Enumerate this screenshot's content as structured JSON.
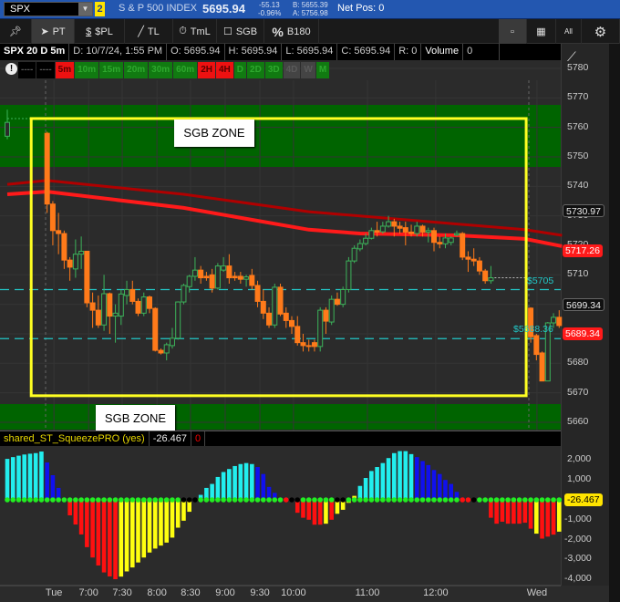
{
  "header": {
    "symbol": "SPX",
    "badge": "2",
    "description": "S & P 500 INDEX",
    "last": "5695.94",
    "change": "-55.13",
    "change_pct": "-0.96%",
    "bid": "B: 5655.39",
    "ask": "A: 5756.98",
    "net_pos": "Net Pos: 0"
  },
  "toolbar": {
    "pt": "PT",
    "spl": "$PL",
    "tl": "TL",
    "tml": "TmL",
    "sgb": "SGB",
    "b180": "B180",
    "all": "All"
  },
  "info": {
    "title": "SPX 20 D 5m",
    "date": "D: 10/7/24, 1:55 PM",
    "open": "O: 5695.94",
    "high": "H: 5695.94",
    "low": "L: 5695.94",
    "close": "C: 5695.94",
    "range": "R: 0",
    "volume_label": "Volume",
    "volume": "0"
  },
  "timeframes": [
    {
      "l": "----",
      "c": "k"
    },
    {
      "l": "----",
      "c": "k"
    },
    {
      "l": "5m",
      "c": "r"
    },
    {
      "l": "10m",
      "c": "g"
    },
    {
      "l": "15m",
      "c": "g"
    },
    {
      "l": "20m",
      "c": "g"
    },
    {
      "l": "30m",
      "c": "g"
    },
    {
      "l": "60m",
      "c": "g"
    },
    {
      "l": "2H",
      "c": "r"
    },
    {
      "l": "4H",
      "c": "r"
    },
    {
      "l": "D",
      "c": "g"
    },
    {
      "l": "2D",
      "c": "g"
    },
    {
      "l": "3D",
      "c": "g"
    },
    {
      "l": "4D",
      "c": "x"
    },
    {
      "l": "W",
      "c": "x"
    },
    {
      "l": "M",
      "c": "g"
    }
  ],
  "annotations": {
    "zone_top": "SGB ZONE",
    "zone_bottom": "SGB ZONE",
    "level1": "$5705",
    "level2": "$5688.36"
  },
  "price_tags": {
    "t1": "5730.97",
    "t2": "5717.26",
    "t3": "5699.34",
    "t4": "5689.34"
  },
  "lower": {
    "study": "shared_ST_SqueezePRO (yes)",
    "value": "-26.467",
    "zero": "0",
    "tag": "-26.467"
  },
  "colors": {
    "up": "#3cb35a",
    "down": "#ff7a1a",
    "zone": "#006400",
    "box": "#ffff22",
    "ma_dark": "#b00000",
    "ma_bright": "#ff1a1a",
    "level": "#22c8c8"
  },
  "chart_data": [
    {
      "type": "candlestick",
      "title": "SPX 20 D 5m",
      "ylim": [
        5655,
        5785
      ],
      "yticks": [
        "5780",
        "5770",
        "5760",
        "5750",
        "5740",
        "5730",
        "5720",
        "5710",
        "5700",
        "5690",
        "5680",
        "5670",
        "5660"
      ],
      "xticks": [
        {
          "l": "Tue",
          "slot": 8.2
        },
        {
          "l": "7:00",
          "slot": 14.3
        },
        {
          "l": "7:30",
          "slot": 20.2
        },
        {
          "l": "8:00",
          "slot": 26.3
        },
        {
          "l": "8:30",
          "slot": 32.2
        },
        {
          "l": "9:00",
          "slot": 38.3
        },
        {
          "l": "9:30",
          "slot": 44.4
        },
        {
          "l": "10:00",
          "slot": 50.3
        },
        {
          "l": "11:00",
          "slot": 63.3
        },
        {
          "l": "12:00",
          "slot": 75.3
        },
        {
          "l": "Wed",
          "slot": 93.1
        }
      ],
      "candles": [
        [
          0,
          5757,
          5766,
          5756,
          5761.7
        ],
        [
          7,
          5758,
          5758.5,
          5731,
          5734
        ],
        [
          8,
          5734,
          5735,
          5720,
          5725
        ],
        [
          9,
          5725,
          5731,
          5717,
          5724
        ],
        [
          10,
          5724,
          5725,
          5712,
          5715
        ],
        [
          11,
          5715,
          5716,
          5708,
          5712.6
        ],
        [
          12,
          5712,
          5722,
          5709,
          5717
        ],
        [
          13,
          5717,
          5723,
          5712,
          5718
        ],
        [
          14,
          5718,
          5718,
          5699,
          5700.5
        ],
        [
          15,
          5700.5,
          5704,
          5692,
          5698
        ],
        [
          16,
          5698,
          5703,
          5692,
          5693
        ],
        [
          17,
          5693,
          5710,
          5691,
          5703.6
        ],
        [
          18,
          5703.6,
          5704,
          5690,
          5696
        ],
        [
          19,
          5696,
          5700,
          5687,
          5697
        ],
        [
          20,
          5696,
          5705,
          5693,
          5703.5
        ],
        [
          21,
          5703,
          5708,
          5700,
          5705
        ],
        [
          22,
          5705,
          5708,
          5700,
          5701
        ],
        [
          23,
          5701,
          5702,
          5696,
          5697
        ],
        [
          24,
          5697,
          5704,
          5696,
          5702.5
        ],
        [
          25,
          5702.5,
          5703,
          5697,
          5698.6
        ],
        [
          26,
          5698.6,
          5699,
          5684,
          5684.4
        ],
        [
          27,
          5684.4,
          5685,
          5683,
          5683.5
        ],
        [
          28,
          5683.5,
          5687,
          5681,
          5686.3
        ],
        [
          29,
          5686,
          5692,
          5685,
          5688.5
        ],
        [
          30,
          5688.5,
          5701,
          5688,
          5700.8
        ],
        [
          31,
          5700.8,
          5707,
          5700,
          5706.4
        ],
        [
          32,
          5706,
          5710,
          5704,
          5709.5
        ],
        [
          33,
          5709.5,
          5716,
          5708,
          5711.6
        ],
        [
          34,
          5711.6,
          5713,
          5707,
          5709
        ],
        [
          35,
          5709.5,
          5711,
          5708,
          5709
        ],
        [
          36,
          5710,
          5712,
          5704,
          5705.5
        ],
        [
          37,
          5705.5,
          5714,
          5705,
          5713
        ],
        [
          38,
          5711.6,
          5716,
          5711,
          5713
        ],
        [
          39,
          5713,
          5717,
          5707,
          5709
        ],
        [
          40,
          5709.5,
          5711,
          5708,
          5709
        ],
        [
          41,
          5709.5,
          5711,
          5707,
          5708.5
        ],
        [
          42,
          5708.5,
          5710,
          5706,
          5709.3
        ],
        [
          43,
          5709.8,
          5712,
          5705,
          5706.4
        ],
        [
          44,
          5706.4,
          5708,
          5699,
          5701
        ],
        [
          45,
          5701,
          5705,
          5695,
          5697
        ],
        [
          46,
          5697,
          5699,
          5692,
          5693
        ],
        [
          47,
          5693,
          5707,
          5692,
          5705.8
        ],
        [
          48,
          5705.8,
          5707,
          5696,
          5696.7
        ],
        [
          49,
          5697,
          5699,
          5692,
          5694.5
        ],
        [
          50,
          5694.5,
          5696,
          5690,
          5692.5
        ],
        [
          51,
          5692.5,
          5696,
          5686,
          5687
        ],
        [
          52,
          5687,
          5690,
          5684,
          5686
        ],
        [
          53,
          5686,
          5688,
          5684,
          5685.7
        ],
        [
          54,
          5687,
          5688,
          5684,
          5685.7
        ],
        [
          55,
          5685.7,
          5699,
          5684,
          5698
        ],
        [
          56,
          5698,
          5699,
          5690,
          5694.3
        ],
        [
          57,
          5694,
          5703,
          5693,
          5701.7
        ],
        [
          58,
          5701.7,
          5704,
          5699.5,
          5700
        ],
        [
          59,
          5700,
          5706,
          5699,
          5705
        ],
        [
          60,
          5705,
          5716,
          5704,
          5714.7
        ],
        [
          61,
          5714.7,
          5720,
          5714,
          5719
        ],
        [
          62,
          5718.8,
          5722,
          5718,
          5720.6
        ],
        [
          63,
          5720.6,
          5724,
          5720,
          5722.4
        ],
        [
          64,
          5722.4,
          5726,
          5722,
          5725
        ],
        [
          65,
          5725,
          5728,
          5723,
          5724.5
        ],
        [
          66,
          5724.6,
          5728,
          5724,
          5726.5
        ],
        [
          67,
          5726.5,
          5730,
          5726,
          5728
        ],
        [
          68,
          5728,
          5729,
          5723,
          5726.5
        ],
        [
          69,
          5726.5,
          5728,
          5724,
          5725.8
        ],
        [
          70,
          5726,
          5728,
          5720,
          5724.5
        ],
        [
          71,
          5724.5,
          5727,
          5723,
          5724
        ],
        [
          72,
          5724,
          5728,
          5723,
          5726.5
        ],
        [
          73,
          5726.5,
          5727,
          5723,
          5724.5
        ],
        [
          74,
          5724.5,
          5726,
          5721,
          5725
        ],
        [
          75,
          5725,
          5726,
          5718,
          5721
        ],
        [
          76,
          5721,
          5723,
          5719,
          5720.5
        ],
        [
          77,
          5720.5,
          5724,
          5719,
          5722.5
        ],
        [
          78,
          5721,
          5723,
          5720,
          5722.5
        ],
        [
          79,
          5723.5,
          5725,
          5723,
          5724
        ],
        [
          80,
          5724,
          5724.5,
          5715,
          5716
        ],
        [
          81,
          5716,
          5718,
          5711,
          5715.3
        ],
        [
          82,
          5715.3,
          5719,
          5713,
          5714.7
        ],
        [
          83,
          5714.7,
          5716,
          5710,
          5711.3
        ],
        [
          84,
          5711.3,
          5712,
          5707,
          5708
        ],
        [
          85,
          5708,
          5713,
          5707,
          5709
        ],
        [
          92,
          5698.7,
          5699,
          5687,
          5689
        ],
        [
          93,
          5689.4,
          5690,
          5681,
          5683
        ],
        [
          94,
          5683.5,
          5684,
          5674,
          5674
        ],
        [
          95,
          5674,
          5694,
          5674,
          5693.7
        ],
        [
          96,
          5693.7,
          5697,
          5692,
          5695.6
        ],
        [
          97,
          5695.6,
          5698,
          5692,
          5692.8
        ]
      ],
      "ma_dark": [
        [
          0,
          5740.7
        ],
        [
          7,
          5742
        ],
        [
          31,
          5737.3
        ],
        [
          53,
          5731.4
        ],
        [
          91,
          5725.3
        ],
        [
          97.5,
          5723.4
        ]
      ],
      "ma_bright": [
        [
          0,
          5737.3
        ],
        [
          7,
          5738.2
        ],
        [
          31,
          5732.7
        ],
        [
          53,
          5725.3
        ],
        [
          62,
          5724
        ],
        [
          79,
          5723.4
        ],
        [
          91,
          5722.2
        ],
        [
          97.5,
          5719.7
        ]
      ],
      "levels": [
        5705,
        5688.36
      ],
      "zones": [
        [
          5745,
          5766
        ],
        [
          5657,
          5666
        ]
      ],
      "box": {
        "slot_from": 4.2,
        "slot_to": 91.2,
        "price_top": 5763,
        "price_bottom": 5669
      },
      "last_line": {
        "slot_from": 85,
        "slot_to": 91,
        "price": 5709
      }
    },
    {
      "type": "bar",
      "title": "shared_ST_SqueezePRO (yes)",
      "ylim": [
        -4200,
        2800
      ],
      "yticks": [
        "2,000",
        "1,000",
        "-1,000",
        "-2,000",
        "-3,000",
        "-4,000"
      ],
      "ytick_values": [
        2000,
        1000,
        -1000,
        -2000,
        -3000,
        -4000
      ],
      "values": [
        2060,
        2150,
        2220,
        2280,
        2320,
        2350,
        2430,
        1880,
        1240,
        600,
        0,
        -780,
        -1240,
        -1740,
        -2380,
        -2900,
        -3300,
        -3650,
        -3850,
        -3990,
        -3860,
        -3600,
        -3400,
        -3150,
        -2900,
        -2650,
        -2450,
        -2300,
        -2150,
        -1900,
        -1400,
        -1050,
        -600,
        0,
        250,
        600,
        800,
        1150,
        1400,
        1550,
        1700,
        1800,
        1850,
        1800,
        1650,
        1300,
        650,
        350,
        100,
        0,
        -300,
        -650,
        -900,
        -1000,
        -1250,
        -1250,
        -1200,
        -1000,
        -700,
        -500,
        -150,
        200,
        700,
        1100,
        1450,
        1650,
        1850,
        2100,
        2350,
        2450,
        2450,
        2300,
        2150,
        1950,
        1750,
        1500,
        1300,
        1000,
        800,
        400,
        100,
        0,
        0,
        -300,
        -600,
        -900,
        -1200,
        -1100,
        -1200,
        -1200,
        -1200,
        -1150,
        -1450,
        -1700,
        -1950,
        -1850,
        -1750,
        -1600
      ],
      "bar_colors": "cccccccbbbnrrrrrrrrryyyyyyyyyyyyynccccccccccbbbbbbnrrrrryryyyyccccccccccbbbbbbbbbbbnnrrrrrrrryrrryyy",
      "dot_black": [
        31,
        32,
        33,
        50,
        51,
        58,
        59,
        82
      ],
      "dot_red": [
        49,
        80,
        81
      ],
      "last": -26.467
    }
  ]
}
